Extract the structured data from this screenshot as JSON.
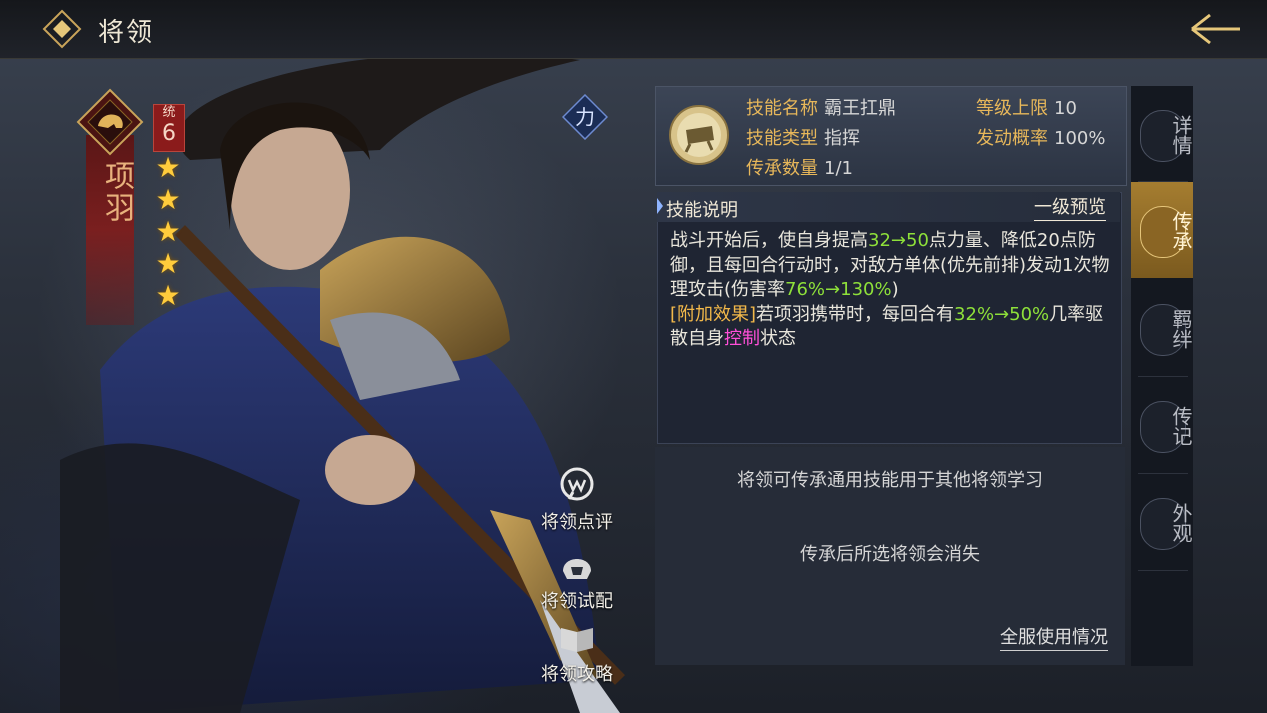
{
  "header": {
    "title": "将领"
  },
  "general": {
    "name": "项羽",
    "stat_label": "统",
    "stat_value": "6",
    "stars": 5,
    "type_badge": "力"
  },
  "side_actions": [
    {
      "label": "将领点评",
      "icon": "comment-bubble-icon"
    },
    {
      "label": "将领试配",
      "icon": "helmet-icon"
    },
    {
      "label": "将领攻略",
      "icon": "book-icon"
    }
  ],
  "skill": {
    "name_label": "技能名称",
    "name_value": "霸王扛鼎",
    "type_label": "技能类型",
    "type_value": "指挥",
    "inherit_label": "传承数量",
    "inherit_value": "1/1",
    "level_cap_label": "等级上限",
    "level_cap_value": "10",
    "trigger_label": "发动概率",
    "trigger_value": "100%"
  },
  "description": {
    "title": "技能说明",
    "preview_link": "一级预览",
    "p1": "战斗开始后，使自身提高",
    "v1": "32→50",
    "p2": "点力量、降低20点防御，且每回合行动时，对敌方单体(优先前排)发动1次物理攻击(伤害率",
    "v2": "76%→130%",
    "p3": ")",
    "extra_tag": "[附加效果]",
    "p4": "若项羽携带时，每回合有",
    "v3": "32%→50%",
    "p5": "几率驱散自身",
    "control": "控制",
    "p6": "状态"
  },
  "lower": {
    "line1": "将领可传承通用技能用于其他将领学习",
    "line2": "传承后所选将领会消失",
    "usage_link": "全服使用情况"
  },
  "tabs": [
    {
      "label": "详情",
      "active": false
    },
    {
      "label": "传承",
      "active": true
    },
    {
      "label": "羁绊",
      "active": false
    },
    {
      "label": "传记",
      "active": false
    },
    {
      "label": "外观",
      "active": false
    }
  ],
  "colors": {
    "accent_gold": "#a57d30",
    "highlight_green": "#8ee03a",
    "highlight_orange": "#f2b84a",
    "highlight_pink": "#ff4fd8",
    "label_gold": "#e7b75a"
  }
}
